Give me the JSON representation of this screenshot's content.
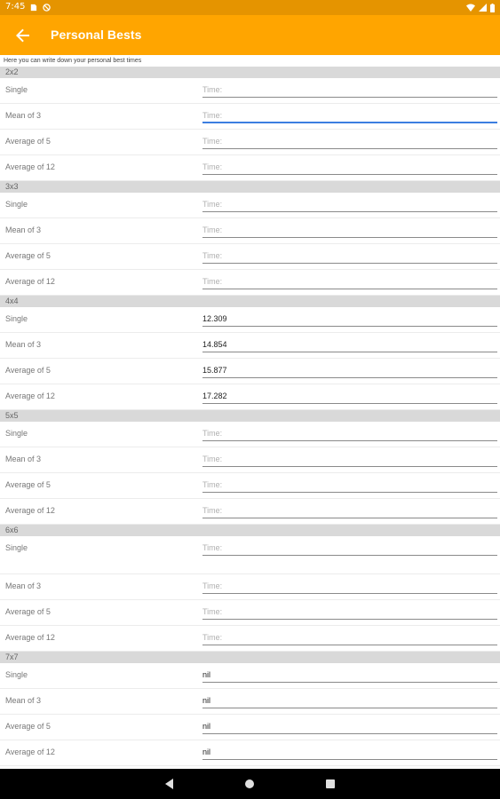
{
  "status_bar": {
    "time": "7:45"
  },
  "app_bar": {
    "title": "Personal Bests"
  },
  "intro_text": "Here you can write down your personal best times",
  "sections": [
    {
      "name": "2x2",
      "rows": [
        {
          "label": "Single",
          "value": "",
          "placeholder": "Time:"
        },
        {
          "label": "Mean of 3",
          "value": "",
          "placeholder": "Time:"
        },
        {
          "label": "Average of 5",
          "value": "",
          "placeholder": "Time:"
        },
        {
          "label": "Average of 12",
          "value": "",
          "placeholder": "Time:"
        }
      ]
    },
    {
      "name": "3x3",
      "rows": [
        {
          "label": "Single",
          "value": "",
          "placeholder": "Time:"
        },
        {
          "label": "Mean of 3",
          "value": "",
          "placeholder": "Time:"
        },
        {
          "label": "Average of 5",
          "value": "",
          "placeholder": "Time:"
        },
        {
          "label": "Average of 12",
          "value": "",
          "placeholder": "Time:"
        }
      ]
    },
    {
      "name": "4x4",
      "rows": [
        {
          "label": "Single",
          "value": "12.309",
          "placeholder": "Time:"
        },
        {
          "label": "Mean of 3",
          "value": "14.854",
          "placeholder": "Time:"
        },
        {
          "label": "Average of 5",
          "value": "15.877",
          "placeholder": "Time:"
        },
        {
          "label": "Average of 12",
          "value": "17.282",
          "placeholder": "Time:"
        }
      ]
    },
    {
      "name": "5x5",
      "rows": [
        {
          "label": "Single",
          "value": "",
          "placeholder": "Time:"
        },
        {
          "label": "Mean of 3",
          "value": "",
          "placeholder": "Time:"
        },
        {
          "label": "Average of 5",
          "value": "",
          "placeholder": "Time:"
        },
        {
          "label": "Average of 12",
          "value": "",
          "placeholder": "Time:"
        }
      ]
    },
    {
      "name": "6x6",
      "rows": [
        {
          "label": "Single",
          "value": "",
          "placeholder": "Time:"
        },
        {
          "label": "Mean of 3",
          "value": "",
          "placeholder": "Time:"
        },
        {
          "label": "Average of 5",
          "value": "",
          "placeholder": "Time:"
        },
        {
          "label": "Average of 12",
          "value": "",
          "placeholder": "Time:"
        }
      ]
    },
    {
      "name": "7x7",
      "rows": [
        {
          "label": "Single",
          "value": "nil",
          "placeholder": "Time:"
        },
        {
          "label": "Mean of 3",
          "value": "nil",
          "placeholder": "Time:"
        },
        {
          "label": "Average of 5",
          "value": "nil",
          "placeholder": "Time:"
        },
        {
          "label": "Average of 12",
          "value": "nil",
          "placeholder": "Time:"
        }
      ]
    }
  ],
  "colors": {
    "app_bar": "#ffa500",
    "status_bar": "#e59400",
    "focus": "#3c7ee0"
  },
  "icons": {
    "back": "arrow-back-icon",
    "nav_back": "triangle-back-icon",
    "nav_home": "circle-home-icon",
    "nav_recents": "square-recents-icon"
  }
}
